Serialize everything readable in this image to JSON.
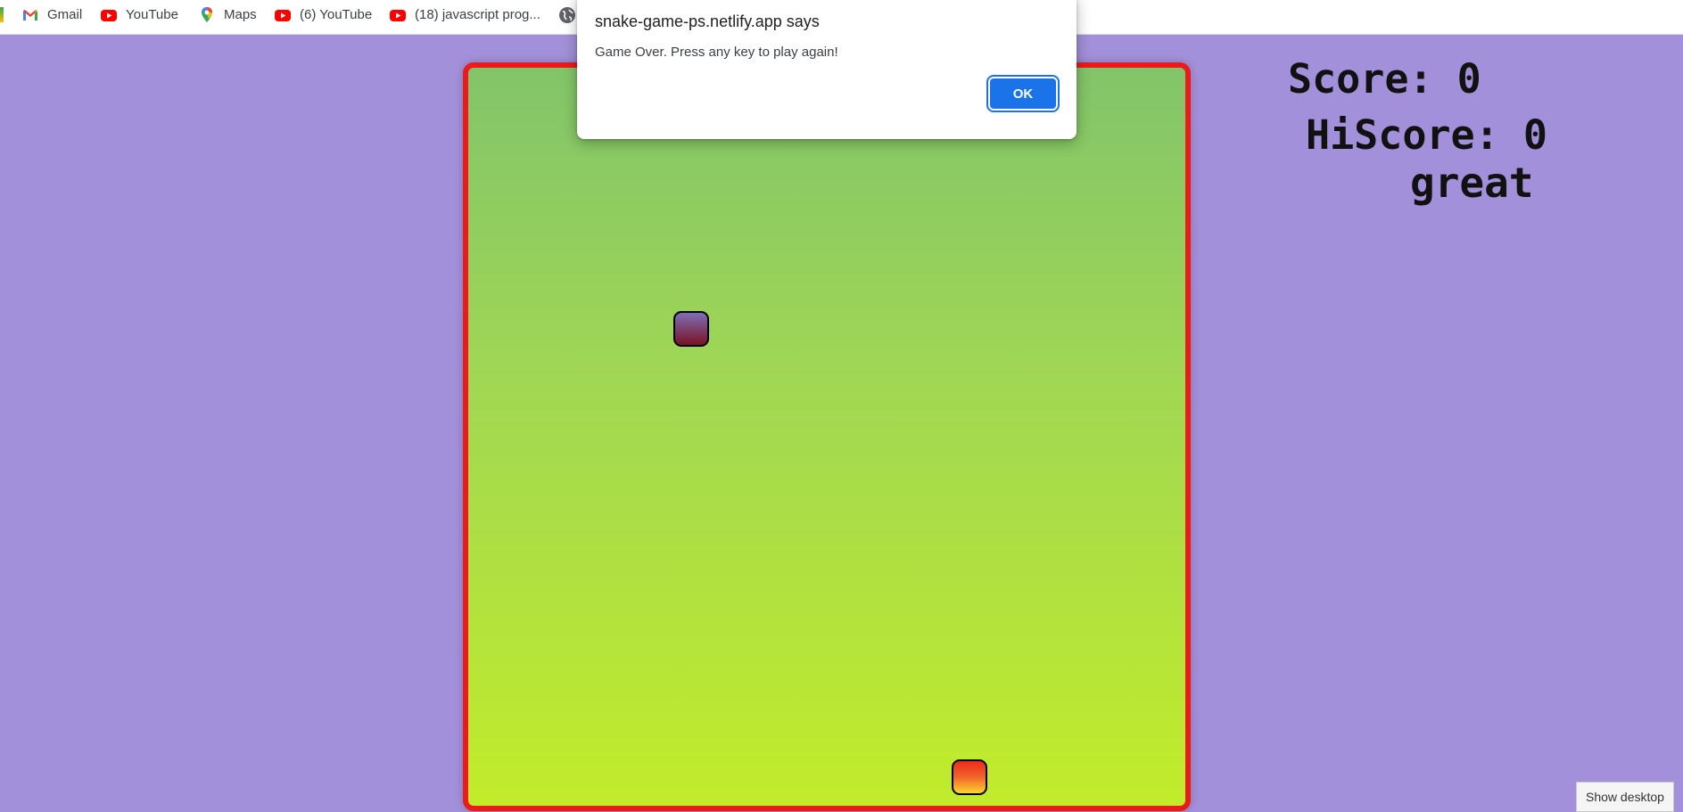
{
  "bookmarks": [
    {
      "label": "Gmail",
      "icon": "gmail-icon"
    },
    {
      "label": "YouTube",
      "icon": "youtube-icon"
    },
    {
      "label": "Maps",
      "icon": "maps-icon"
    },
    {
      "label": "(6) YouTube",
      "icon": "youtube-icon"
    },
    {
      "label": "(18) javascript prog...",
      "icon": "youtube-icon"
    },
    {
      "label": "",
      "icon": "globe-icon"
    }
  ],
  "game": {
    "score_text": "Score: 0",
    "hiscore_text": "HiScore: 0",
    "message": "great",
    "colors": {
      "background": "#a390da",
      "board_border": "#ec1a1a",
      "board_gradient_top": "#82c46a",
      "board_gradient_bottom": "#c2ec2a",
      "food_top": "#7e6fb7",
      "food_bottom": "#7a1124",
      "snake_top": "#e92c1c",
      "snake_bottom": "#fbd62b"
    }
  },
  "dialog": {
    "title": "snake-game-ps.netlify.app says",
    "message": "Game Over. Press any key to play again!",
    "ok_label": "OK",
    "accent": "#1a73e8"
  },
  "taskbar": {
    "show_desktop_label": "Show desktop"
  }
}
